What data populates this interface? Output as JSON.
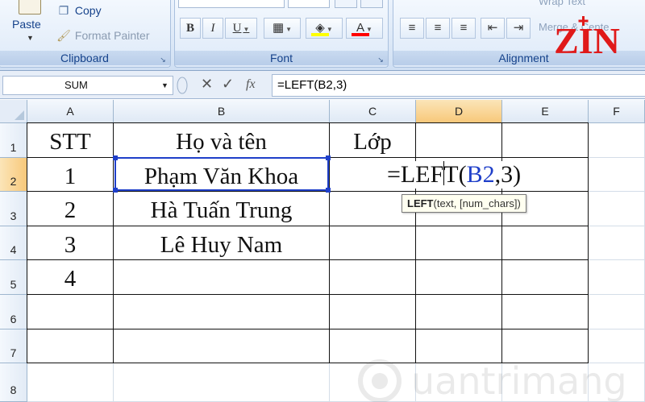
{
  "ribbon": {
    "clipboard": {
      "label": "Clipboard",
      "paste_label": "Paste",
      "copy_label": "Copy",
      "format_painter_label": "Format Painter"
    },
    "font": {
      "label": "Font",
      "bold": "B",
      "italic": "I",
      "underline": "U",
      "font_color_glyph": "A",
      "fill_color": "#ffff00",
      "font_color": "#ff0000"
    },
    "alignment": {
      "label": "Alignment",
      "wrap_text_label": "Wrap Text",
      "merge_label": "Merge & Cente"
    }
  },
  "logo": {
    "text": "ZIN",
    "color": "#e01a1a"
  },
  "formula_bar": {
    "name_box": "SUM",
    "cancel_glyph": "✕",
    "enter_glyph": "✓",
    "insert_function_glyph": "fx",
    "formula": "=LEFT(B2,3)"
  },
  "sheet": {
    "columns": [
      "A",
      "B",
      "C",
      "D",
      "E",
      "F"
    ],
    "rows": [
      "1",
      "2",
      "3",
      "4",
      "5",
      "6",
      "7",
      "8"
    ],
    "active_column": "D",
    "active_row": "2",
    "cells": {
      "A1": "STT",
      "B1": "Họ và tên",
      "C1": "Lớp",
      "A2": "1",
      "B2": "Phạm Văn Khoa",
      "A3": "2",
      "B3": "Hà Tuấn Trung",
      "A4": "3",
      "B4": "Lê Huy Nam",
      "A5": "4"
    },
    "editing": {
      "prefix": "=LEF",
      "after_caret": "T(",
      "ref": "B2",
      "suffix": ",3)",
      "ref_color": "#1f3fc9"
    },
    "tooltip": {
      "function_name": "LEFT",
      "args": "(text, [num_chars])"
    }
  },
  "watermark": {
    "text": "uantrimang"
  }
}
